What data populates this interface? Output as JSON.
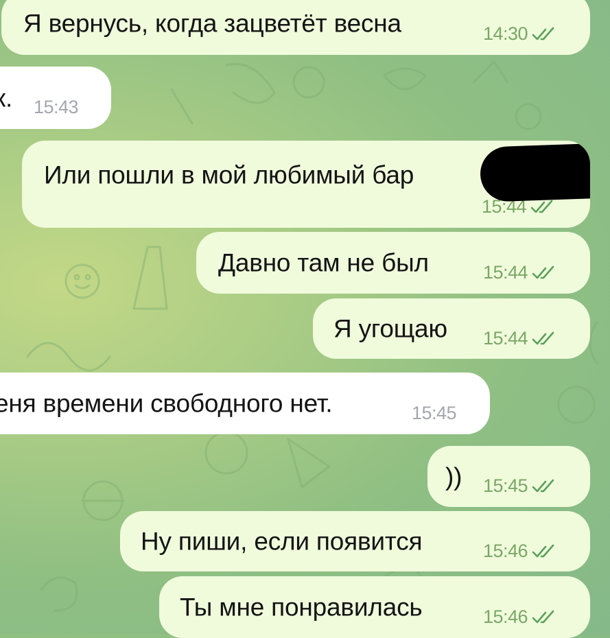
{
  "chat": {
    "messages": [
      {
        "direction": "out",
        "text": "Я вернусь, когда зацветёт весна",
        "time": "14:30",
        "read": true
      },
      {
        "direction": "in",
        "text": "к.",
        "time": "15:43"
      },
      {
        "direction": "out",
        "text": "Или пошли в мой любимый бар",
        "time": "15:44",
        "read": true,
        "redacted": true
      },
      {
        "direction": "out",
        "text": "Давно там не был",
        "time": "15:44",
        "read": true
      },
      {
        "direction": "out",
        "text": "Я угощаю",
        "time": "15:44",
        "read": true
      },
      {
        "direction": "in",
        "text": "еня времени свободного нет.",
        "time": "15:45"
      },
      {
        "direction": "out",
        "text": "))",
        "time": "15:45",
        "read": true
      },
      {
        "direction": "out",
        "text": "Ну пиши, если появится",
        "time": "15:46",
        "read": true
      },
      {
        "direction": "out",
        "text": "Ты мне понравилась",
        "time": "15:46",
        "read": true
      }
    ],
    "status_icon": "double-check-icon",
    "colors": {
      "outgoing_bubble": "#f0fbdc",
      "incoming_bubble": "#ffffff",
      "outgoing_meta": "#7aa766",
      "incoming_meta": "#a3a7ad",
      "wallpaper": "#9cc585"
    }
  }
}
